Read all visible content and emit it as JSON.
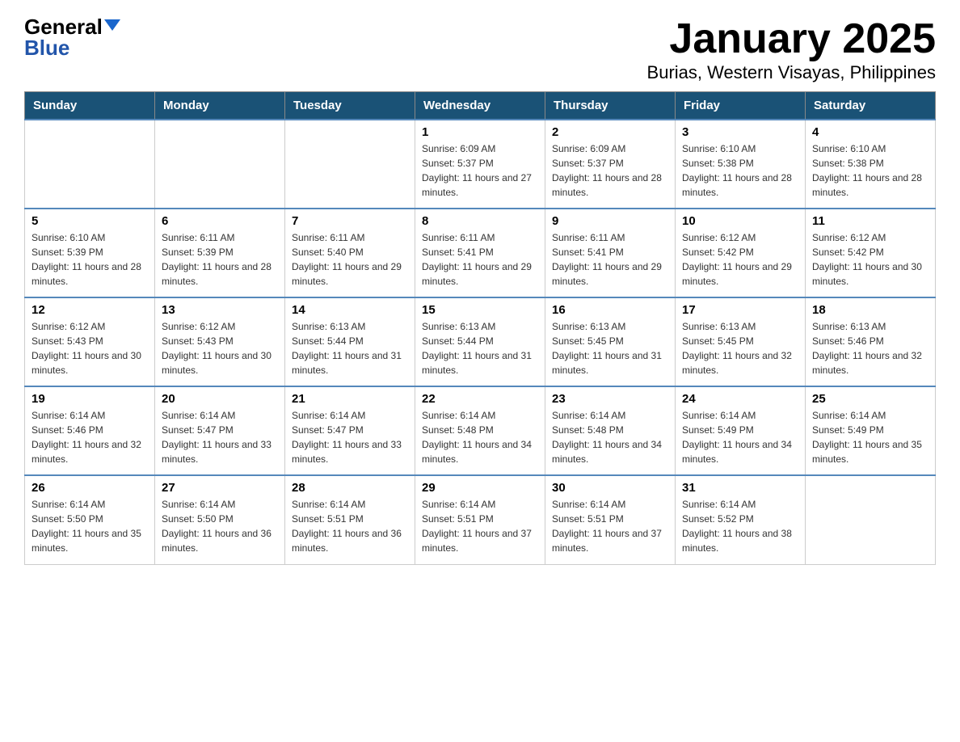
{
  "logo": {
    "general": "General",
    "blue": "Blue"
  },
  "title": "January 2025",
  "subtitle": "Burias, Western Visayas, Philippines",
  "header_color": "#1a5276",
  "days": [
    "Sunday",
    "Monday",
    "Tuesday",
    "Wednesday",
    "Thursday",
    "Friday",
    "Saturday"
  ],
  "weeks": [
    [
      {
        "day": "",
        "info": ""
      },
      {
        "day": "",
        "info": ""
      },
      {
        "day": "",
        "info": ""
      },
      {
        "day": "1",
        "info": "Sunrise: 6:09 AM\nSunset: 5:37 PM\nDaylight: 11 hours and 27 minutes."
      },
      {
        "day": "2",
        "info": "Sunrise: 6:09 AM\nSunset: 5:37 PM\nDaylight: 11 hours and 28 minutes."
      },
      {
        "day": "3",
        "info": "Sunrise: 6:10 AM\nSunset: 5:38 PM\nDaylight: 11 hours and 28 minutes."
      },
      {
        "day": "4",
        "info": "Sunrise: 6:10 AM\nSunset: 5:38 PM\nDaylight: 11 hours and 28 minutes."
      }
    ],
    [
      {
        "day": "5",
        "info": "Sunrise: 6:10 AM\nSunset: 5:39 PM\nDaylight: 11 hours and 28 minutes."
      },
      {
        "day": "6",
        "info": "Sunrise: 6:11 AM\nSunset: 5:39 PM\nDaylight: 11 hours and 28 minutes."
      },
      {
        "day": "7",
        "info": "Sunrise: 6:11 AM\nSunset: 5:40 PM\nDaylight: 11 hours and 29 minutes."
      },
      {
        "day": "8",
        "info": "Sunrise: 6:11 AM\nSunset: 5:41 PM\nDaylight: 11 hours and 29 minutes."
      },
      {
        "day": "9",
        "info": "Sunrise: 6:11 AM\nSunset: 5:41 PM\nDaylight: 11 hours and 29 minutes."
      },
      {
        "day": "10",
        "info": "Sunrise: 6:12 AM\nSunset: 5:42 PM\nDaylight: 11 hours and 29 minutes."
      },
      {
        "day": "11",
        "info": "Sunrise: 6:12 AM\nSunset: 5:42 PM\nDaylight: 11 hours and 30 minutes."
      }
    ],
    [
      {
        "day": "12",
        "info": "Sunrise: 6:12 AM\nSunset: 5:43 PM\nDaylight: 11 hours and 30 minutes."
      },
      {
        "day": "13",
        "info": "Sunrise: 6:12 AM\nSunset: 5:43 PM\nDaylight: 11 hours and 30 minutes."
      },
      {
        "day": "14",
        "info": "Sunrise: 6:13 AM\nSunset: 5:44 PM\nDaylight: 11 hours and 31 minutes."
      },
      {
        "day": "15",
        "info": "Sunrise: 6:13 AM\nSunset: 5:44 PM\nDaylight: 11 hours and 31 minutes."
      },
      {
        "day": "16",
        "info": "Sunrise: 6:13 AM\nSunset: 5:45 PM\nDaylight: 11 hours and 31 minutes."
      },
      {
        "day": "17",
        "info": "Sunrise: 6:13 AM\nSunset: 5:45 PM\nDaylight: 11 hours and 32 minutes."
      },
      {
        "day": "18",
        "info": "Sunrise: 6:13 AM\nSunset: 5:46 PM\nDaylight: 11 hours and 32 minutes."
      }
    ],
    [
      {
        "day": "19",
        "info": "Sunrise: 6:14 AM\nSunset: 5:46 PM\nDaylight: 11 hours and 32 minutes."
      },
      {
        "day": "20",
        "info": "Sunrise: 6:14 AM\nSunset: 5:47 PM\nDaylight: 11 hours and 33 minutes."
      },
      {
        "day": "21",
        "info": "Sunrise: 6:14 AM\nSunset: 5:47 PM\nDaylight: 11 hours and 33 minutes."
      },
      {
        "day": "22",
        "info": "Sunrise: 6:14 AM\nSunset: 5:48 PM\nDaylight: 11 hours and 34 minutes."
      },
      {
        "day": "23",
        "info": "Sunrise: 6:14 AM\nSunset: 5:48 PM\nDaylight: 11 hours and 34 minutes."
      },
      {
        "day": "24",
        "info": "Sunrise: 6:14 AM\nSunset: 5:49 PM\nDaylight: 11 hours and 34 minutes."
      },
      {
        "day": "25",
        "info": "Sunrise: 6:14 AM\nSunset: 5:49 PM\nDaylight: 11 hours and 35 minutes."
      }
    ],
    [
      {
        "day": "26",
        "info": "Sunrise: 6:14 AM\nSunset: 5:50 PM\nDaylight: 11 hours and 35 minutes."
      },
      {
        "day": "27",
        "info": "Sunrise: 6:14 AM\nSunset: 5:50 PM\nDaylight: 11 hours and 36 minutes."
      },
      {
        "day": "28",
        "info": "Sunrise: 6:14 AM\nSunset: 5:51 PM\nDaylight: 11 hours and 36 minutes."
      },
      {
        "day": "29",
        "info": "Sunrise: 6:14 AM\nSunset: 5:51 PM\nDaylight: 11 hours and 37 minutes."
      },
      {
        "day": "30",
        "info": "Sunrise: 6:14 AM\nSunset: 5:51 PM\nDaylight: 11 hours and 37 minutes."
      },
      {
        "day": "31",
        "info": "Sunrise: 6:14 AM\nSunset: 5:52 PM\nDaylight: 11 hours and 38 minutes."
      },
      {
        "day": "",
        "info": ""
      }
    ]
  ]
}
